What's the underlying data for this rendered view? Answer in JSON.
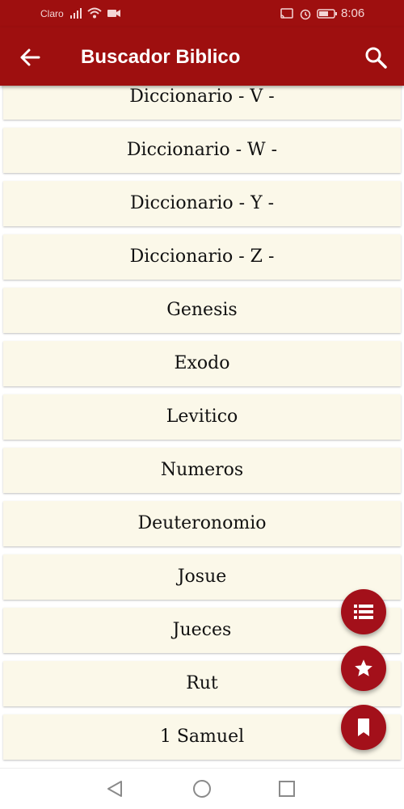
{
  "status_bar": {
    "carrier": "Claro",
    "time": "8:06"
  },
  "app_bar": {
    "title": "Buscador Biblico",
    "back_icon": "arrow-left-icon",
    "search_icon": "search-icon"
  },
  "list": {
    "items": [
      "Diccionario - V -",
      "Diccionario - W -",
      "Diccionario - Y -",
      "Diccionario - Z -",
      "Genesis",
      "Exodo",
      "Levitico",
      "Numeros",
      "Deuteronomio",
      "Josue",
      "Jueces",
      "Rut",
      "1 Samuel"
    ]
  },
  "fabs": {
    "list_icon": "list-icon",
    "favorites_icon": "star-icon",
    "bookmarks_icon": "bookmark-icon"
  },
  "colors": {
    "primary": "#9e0f0f",
    "fab": "#a3101a",
    "item_background": "#fbf8e9"
  }
}
